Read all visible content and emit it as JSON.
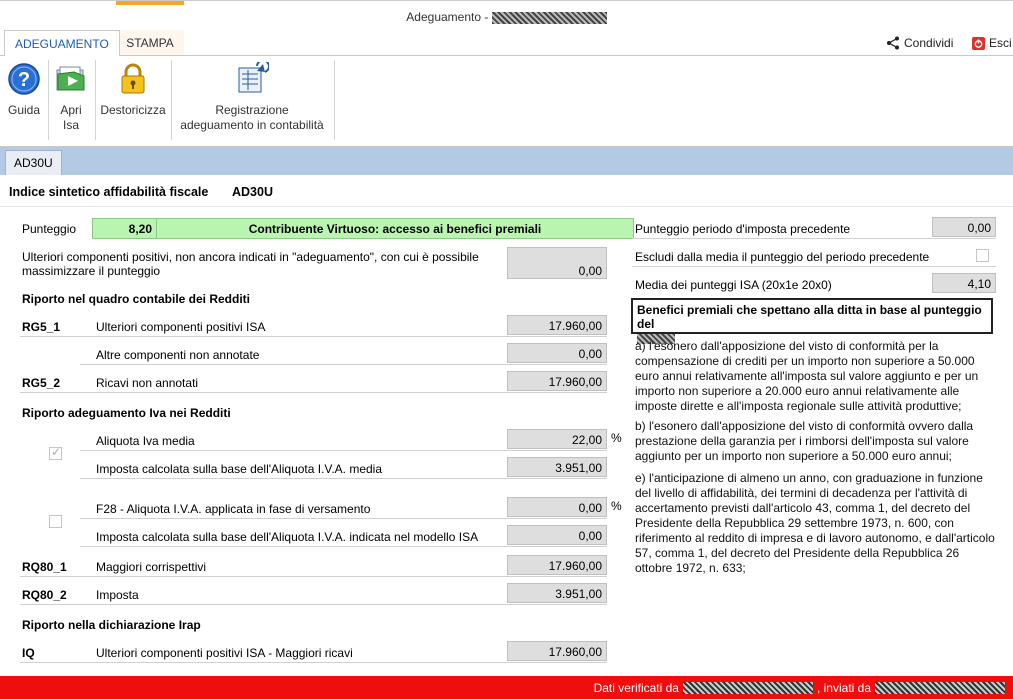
{
  "window": {
    "title": "Adeguamento -"
  },
  "ribbon_tabs": [
    {
      "label": "ADEGUAMENTO"
    },
    {
      "label": "STAMPA"
    }
  ],
  "ribbon_right": {
    "share_label": "Condividi",
    "exit_label": "Esci"
  },
  "ribbon": {
    "guida": "Guida",
    "apri_1": "Apri",
    "apri_2": "Isa",
    "destoricizza": "Destoricizza",
    "registrazione_1": "Registrazione",
    "registrazione_2": "adeguamento in contabilità"
  },
  "doc_tab": "AD30U",
  "header": {
    "title": "Indice sintetico affidabilità fiscale",
    "code": "AD30U"
  },
  "left": {
    "punteggio_label": "Punteggio",
    "punteggio_value": "8,20",
    "punteggio_desc": "Contribuente Virtuoso: accesso ai benefici premiali",
    "ulteriori_1": "Ulteriori componenti positivi, non ancora indicati in \"adeguamento\", con cui è possibile",
    "ulteriori_2": "massimizzare il punteggio",
    "ulteriori_value": "0,00",
    "sec_redditi": "Riporto nel quadro contabile dei Redditi",
    "rg5_1_code": "RG5_1",
    "rg5_1_label": "Ulteriori componenti positivi ISA",
    "rg5_1_value": "17.960,00",
    "altre_label": "Altre componenti non annotate",
    "altre_value": "0,00",
    "rg5_2_code": "RG5_2",
    "rg5_2_label": "Ricavi non annotati",
    "rg5_2_value": "17.960,00",
    "sec_iva": "Riporto adeguamento Iva nei Redditi",
    "aliquota_label": "Aliquota Iva media",
    "aliquota_value": "22,00",
    "pct": "%",
    "imposta1_label": "Imposta calcolata sulla base dell'Aliquota I.V.A. media",
    "imposta1_value": "3.951,00",
    "f28_label": "F28 - Aliquota I.V.A. applicata in fase di versamento",
    "f28_value": "0,00",
    "imposta2_label": "Imposta calcolata sulla base dell'Aliquota I.V.A. indicata nel modello ISA",
    "imposta2_value": "0,00",
    "rq80_1_code": "RQ80_1",
    "rq80_1_label": "Maggiori corrispettivi",
    "rq80_1_value": "17.960,00",
    "rq80_2_code": "RQ80_2",
    "rq80_2_label": "Imposta",
    "rq80_2_value": "3.951,00",
    "sec_irap": "Riporto nella dichiarazione Irap",
    "iq_code": "IQ",
    "iq_label": "Ulteriori componenti positivi ISA - Maggiori ricavi",
    "iq_value": "17.960,00"
  },
  "right": {
    "prec_label": "Punteggio periodo d'imposta precedente",
    "prec_value": "0,00",
    "escludi_label": "Escludi dalla media il punteggio del periodo precedente",
    "media_label": "Media dei punteggi ISA (20x1e 20x0)",
    "media_value": "4,10",
    "benefici_title": "Benefici premiali che spettano alla ditta in base al punteggio del",
    "para_a": "a) l'esonero dall'apposizione del visto di conformità per la compensazione di crediti per un importo non superiore a 50.000 euro annui relativamente all'imposta sul valore aggiunto e per un importo non superiore a 20.000 euro annui relativamente alle imposte dirette e all'imposta regionale sulle attività produttive;",
    "para_b": "b) l'esonero dall'apposizione del visto di conformità ovvero dalla prestazione della garanzia per i rimborsi dell'imposta sul valore aggiunto per un importo non superiore a 50.000 euro annui;",
    "para_e": "e) l'anticipazione di almeno un anno, con graduazione in funzione del livello di affidabilità, dei termini di decadenza per l'attività di accertamento previsti dall'articolo 43, comma 1, del decreto del Presidente della Repubblica 29 settembre 1973, n. 600, con riferimento al reddito di impresa e di lavoro autonomo, e dall'articolo 57, comma 1, del decreto del Presidente della Repubblica 26 ottobre 1972, n. 633;"
  },
  "status": {
    "verified": "Dati verificati da",
    "sent": ", inviati da"
  },
  "colors": {
    "score_bg": "#b9f5b1",
    "status_bg": "#ef0e0e",
    "accent": "#1e5fae",
    "tabstrip": "#b4c9e4"
  }
}
